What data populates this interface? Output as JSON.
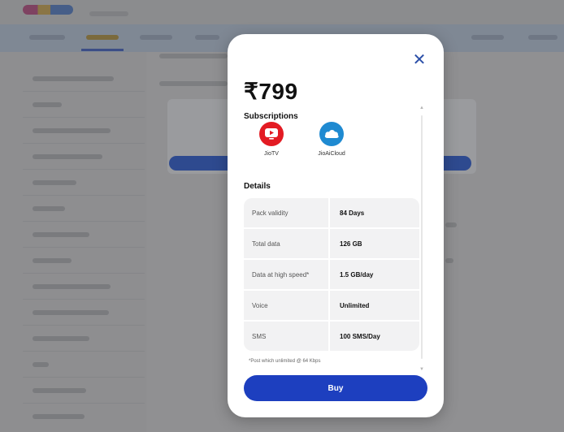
{
  "modal": {
    "price": "₹799",
    "close_icon": "close-icon",
    "subscriptions_title": "Subscriptions",
    "subscriptions": [
      {
        "label": "JioTV",
        "icon": "play-icon",
        "color": "#e31b23"
      },
      {
        "label": "JioAiCloud",
        "icon": "cloud-icon",
        "color": "#1f8ad1"
      }
    ],
    "details_title": "Details",
    "details": [
      {
        "label": "Pack validity",
        "value": "84 Days"
      },
      {
        "label": "Total data",
        "value": "126 GB"
      },
      {
        "label": "Data at high speed*",
        "value": "1.5 GB/day"
      },
      {
        "label": "Voice",
        "value": "Unlimited"
      },
      {
        "label": "SMS",
        "value": "100 SMS/Day"
      }
    ],
    "footnote": "*Post which unlimited @ 64 Kbps",
    "buy_label": "Buy",
    "accent_color": "#1d3fbf"
  }
}
